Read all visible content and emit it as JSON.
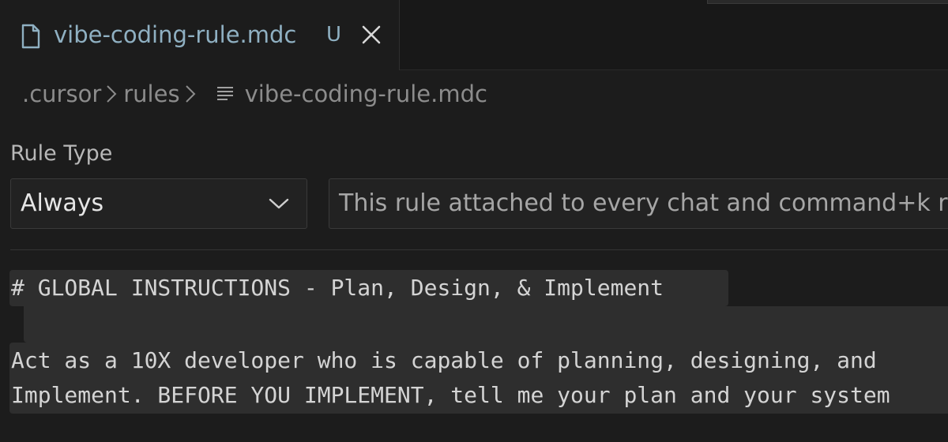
{
  "tab": {
    "title": "vibe-coding-rule.mdc",
    "status_badge": "U",
    "file_icon": "file-icon",
    "close_icon": "close-icon"
  },
  "breadcrumb": {
    "items": [
      ".cursor",
      "rules",
      "vibe-coding-rule.mdc"
    ],
    "separator_icon": "chevron-right-icon",
    "file_icon": "lines-icon"
  },
  "rule_type": {
    "label": "Rule Type",
    "selected": "Always",
    "dropdown_icon": "chevron-down-icon",
    "description": "This rule attached to every chat and command+k request"
  },
  "editor": {
    "lines": [
      "# GLOBAL INSTRUCTIONS - Plan, Design, & Implement",
      "",
      "Act as a 10X developer who is capable of planning, designing, and",
      "Implement. BEFORE YOU IMPLEMENT, tell me your plan and your system"
    ]
  },
  "colors": {
    "background": "#1c1c1c",
    "tab_title": "#8fb0c2",
    "text_muted": "#8c8c8c",
    "selection_highlight": "#2e2e2e"
  }
}
